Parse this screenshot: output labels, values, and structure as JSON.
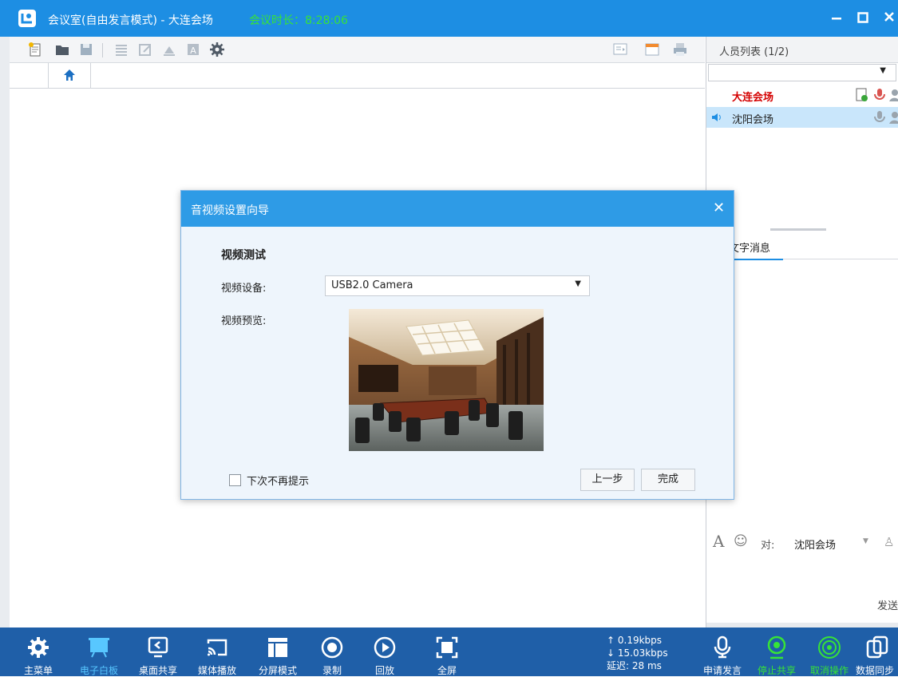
{
  "window": {
    "title": "会议室(自由发言模式) - 大连会场",
    "duration_label": "会议时长：8:28:06"
  },
  "participants": {
    "header": "人员列表 (1/2)",
    "items": [
      {
        "name": "大连会场",
        "color": "#d40000"
      },
      {
        "name": "沈阳会场",
        "color": "#222222"
      }
    ]
  },
  "messages": {
    "tab": "文字消息",
    "to_label": "对:",
    "to_value": "沈阳会场",
    "send": "发送"
  },
  "dialog": {
    "title": "音视频设置向导",
    "heading": "视频测试",
    "device_label": "视频设备:",
    "device_value": "USB2.0 Camera",
    "preview_label": "视频预览:",
    "checkbox_label": "下次不再提示",
    "prev_button": "上一步",
    "finish_button": "完成"
  },
  "bottombar": {
    "items": [
      "主菜单",
      "电子白板",
      "桌面共享",
      "媒体播放",
      "分屏模式",
      "录制",
      "回放",
      "全屏"
    ],
    "right_items": [
      "申请发言",
      "停止共享",
      "取消操作",
      "数据同步"
    ],
    "stats": {
      "up": "↑ 0.19kbps",
      "down": "↓ 15.03kbps",
      "latency": "延迟: 28 ms"
    }
  },
  "colors": {
    "titlebar": "#1d8ee3",
    "bottombar": "#1f5fa8",
    "accent_green": "#37e337",
    "active_blue": "#58c7ff"
  }
}
